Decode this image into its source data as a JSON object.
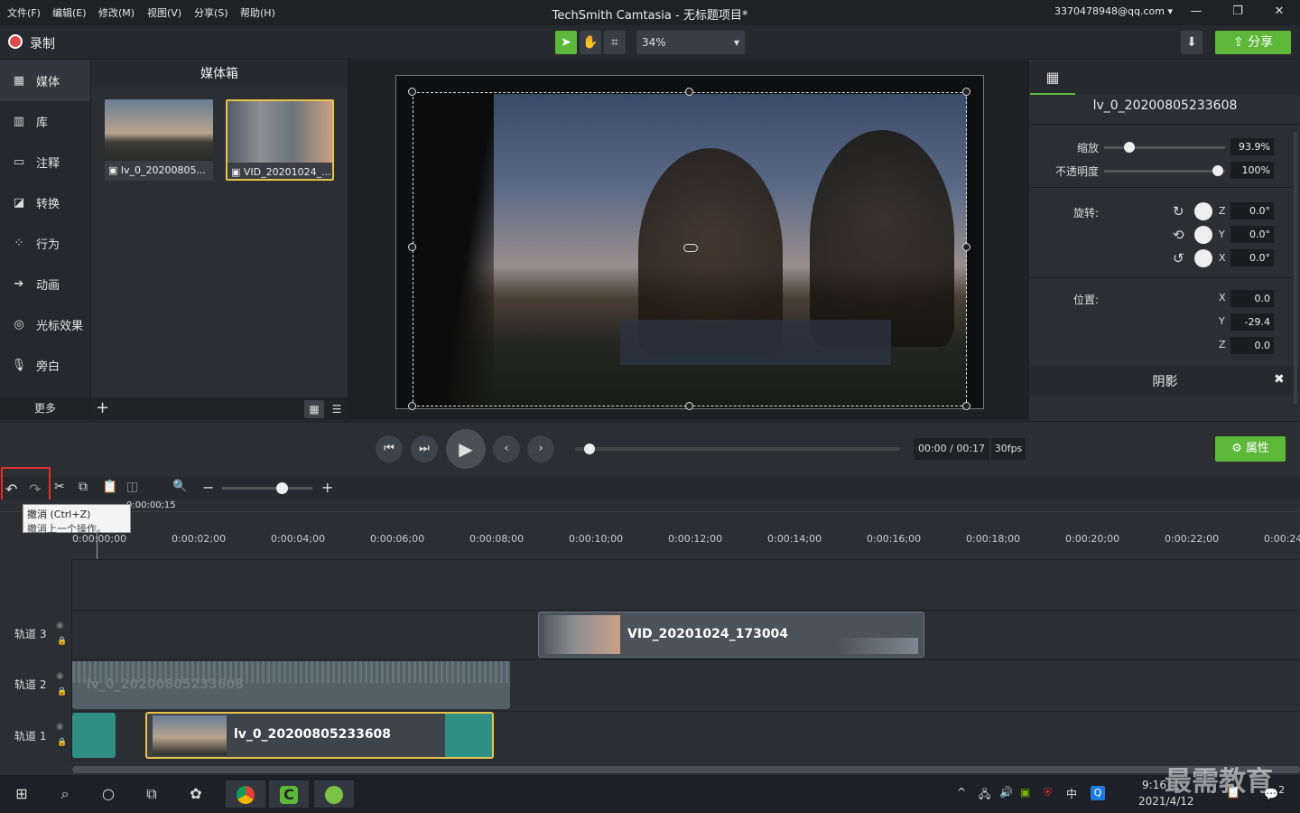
{
  "menu": [
    "文件(F)",
    "编辑(E)",
    "修改(M)",
    "视图(V)",
    "分享(S)",
    "帮助(H)"
  ],
  "app_title": "TechSmith Camtasia - 无标题项目*",
  "account": "3370478948@qq.com",
  "record_label": "录制",
  "zoom": "34%",
  "share_label": "分享",
  "nav": [
    {
      "label": "媒体",
      "icon": "film-icon"
    },
    {
      "label": "库",
      "icon": "library-icon"
    },
    {
      "label": "注释",
      "icon": "annotation-icon"
    },
    {
      "label": "转换",
      "icon": "transition-icon"
    },
    {
      "label": "行为",
      "icon": "behavior-icon"
    },
    {
      "label": "动画",
      "icon": "animation-icon"
    },
    {
      "label": "光标效果",
      "icon": "cursor-effect-icon"
    },
    {
      "label": "旁白",
      "icon": "microphone-icon"
    }
  ],
  "more_label": "更多",
  "mediabin": {
    "title": "媒体箱",
    "items": [
      "lv_0_20200805...",
      "VID_20201024_..."
    ]
  },
  "props": {
    "clip_name": "lv_0_20200805233608",
    "scale_label": "缩放",
    "scale_value": "93.9%",
    "opacity_label": "不透明度",
    "opacity_value": "100%",
    "rotation_label": "旋转:",
    "rot_z": "0.0°",
    "rot_y": "0.0°",
    "rot_x": "0.0°",
    "position_label": "位置:",
    "pos_x": "0.0",
    "pos_y": "-29.4",
    "pos_z": "0.0",
    "shadow_label": "阴影",
    "axis_z": "Z",
    "axis_y": "Y",
    "axis_x": "X"
  },
  "playback": {
    "time": "00:00 / 00:17",
    "fps": "30fps",
    "position": 0.0,
    "props_button": "属性"
  },
  "tooltip": {
    "title": "撤消 (Ctrl+Z)",
    "desc": "撤消上一个操作。"
  },
  "playhead_time": "0:00:00;15",
  "timeline_zoom": 0.5,
  "ruler_ticks": [
    "0:00:00;00",
    "0:00:02;00",
    "0:00:04;00",
    "0:00:06;00",
    "0:00:08;00",
    "0:00:10;00",
    "0:00:12;00",
    "0:00:14;00",
    "0:00:16;00",
    "0:00:18;00",
    "0:00:20;00",
    "0:00:22;00",
    "0:00:24"
  ],
  "tracks": [
    {
      "label": "轨道 3",
      "clip": "VID_20201024_173004"
    },
    {
      "label": "轨道 2",
      "clip": "lv_0_20200805233608"
    },
    {
      "label": "轨道 1",
      "clip": "lv_0_20200805233608"
    }
  ],
  "taskbar": {
    "time": "9:16",
    "date": "2021/4/12",
    "ime": "中",
    "notif": "2"
  },
  "watermark": "最需教育"
}
